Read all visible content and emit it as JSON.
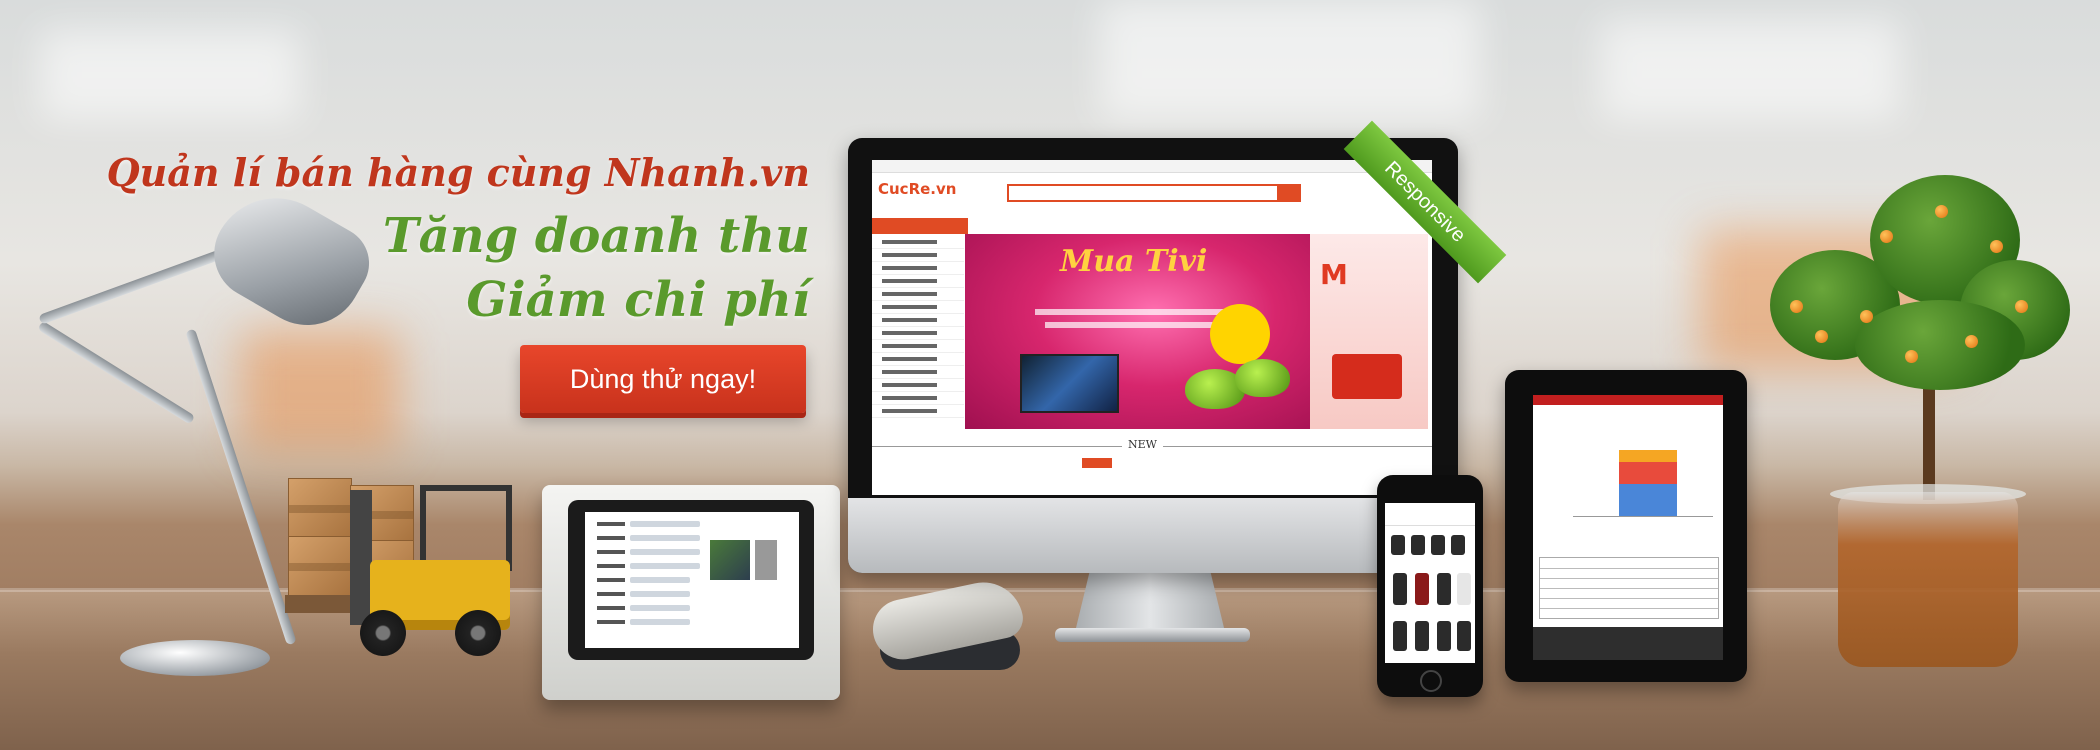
{
  "hero": {
    "line1": "Quản lí bán hàng cùng Nhanh.vn",
    "line2": "Tăng doanh thu",
    "line3": "Giảm chi phí",
    "cta_label": "Dùng thử ngay!"
  },
  "devices": {
    "monitor_badge": "Responsive",
    "site_logo": "CucRe.vn",
    "site_banner_title": "Mua Tivi",
    "site_side_ad": "M",
    "site_section": "NEW"
  },
  "colors": {
    "accent_red": "#d8391f",
    "accent_green": "#5a9a2c"
  },
  "icons": [
    "desk-lamp-icon",
    "forklift-icon",
    "ipad-stand-icon",
    "barcode-scanner-icon",
    "monitor-icon",
    "phone-icon",
    "tablet-icon",
    "plant-icon"
  ]
}
